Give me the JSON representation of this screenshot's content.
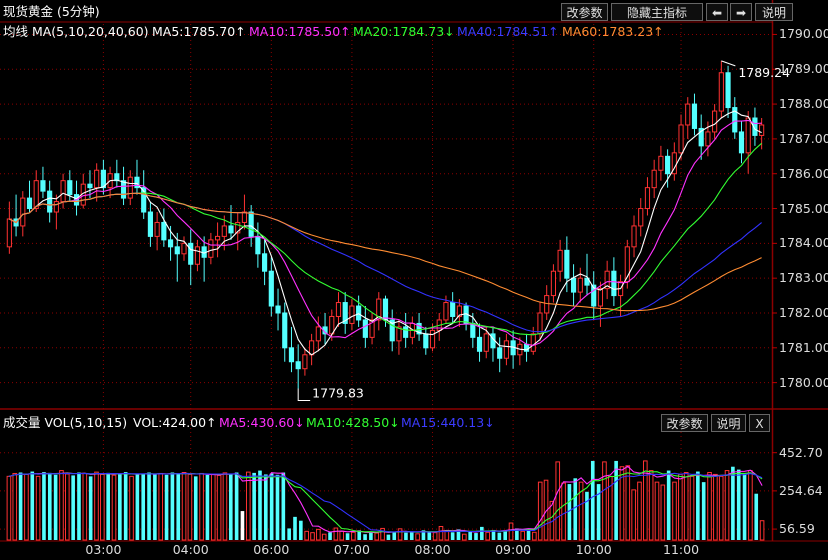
{
  "header": {
    "title": "现货黄金 (5分钟)",
    "btn_params": "改参数",
    "btn_hide": "隐藏主指标",
    "btn_left": "⬅",
    "btn_right": "➡",
    "btn_help": "说明"
  },
  "ma_legend": {
    "label": "均线 MA(5,10,20,40,60)",
    "ma5": "MA5:1785.70↑",
    "ma10": "MA10:1785.50↑",
    "ma20": "MA20:1784.73↓",
    "ma40": "MA40:1784.51↑",
    "ma60": "MA60:1783.23↑"
  },
  "vol_legend": {
    "label": "成交量 VOL(5,10,15)",
    "vol": "VOL:424.00↑",
    "ma5": "MA5:430.60↓",
    "ma10": "MA10:428.50↓",
    "ma15": "MA15:440.13↓",
    "btn_params": "改参数",
    "btn_help": "说明",
    "btn_close": "X"
  },
  "colors": {
    "up": "#ff3232",
    "down": "#54ffff",
    "ma5": "#ffffff",
    "ma10": "#ff32ff",
    "ma20": "#32ff32",
    "ma40": "#3232ff",
    "ma60": "#ff8c32",
    "grid": "#8b0000"
  },
  "chart_data": [
    {
      "type": "candlestick",
      "title": "现货黄金 (5分钟)",
      "ylim": [
        1779.3,
        1790.3
      ],
      "yticks": [
        "1790.00",
        "1789.00",
        "1788.00",
        "1787.00",
        "1786.00",
        "1785.00",
        "1784.00",
        "1783.00",
        "1782.00",
        "1781.00",
        "1780.00"
      ],
      "xticks": [
        "03:00",
        "04:00",
        "06:00",
        "07:00",
        "08:00",
        "09:00",
        "10:00",
        "11:00"
      ],
      "annotations": [
        {
          "text": "1789.24",
          "price": 1789.24
        },
        {
          "text": "1779.83",
          "price": 1779.83
        }
      ],
      "ohlc": [
        [
          1783.9,
          1785.2,
          1783.7,
          1784.7
        ],
        [
          1784.7,
          1785.4,
          1784.2,
          1784.5
        ],
        [
          1784.5,
          1785.5,
          1784.2,
          1785.3
        ],
        [
          1785.3,
          1785.8,
          1784.9,
          1785.0
        ],
        [
          1785.0,
          1786.1,
          1784.9,
          1785.8
        ],
        [
          1785.8,
          1786.2,
          1785.3,
          1785.5
        ],
        [
          1785.5,
          1785.8,
          1784.6,
          1784.9
        ],
        [
          1784.9,
          1785.4,
          1784.4,
          1785.2
        ],
        [
          1785.2,
          1786.0,
          1785.0,
          1785.8
        ],
        [
          1785.8,
          1786.1,
          1785.2,
          1785.4
        ],
        [
          1785.4,
          1785.8,
          1784.8,
          1785.1
        ],
        [
          1785.1,
          1786.0,
          1785.0,
          1785.7
        ],
        [
          1785.7,
          1786.1,
          1785.3,
          1785.6
        ],
        [
          1785.6,
          1786.3,
          1785.2,
          1786.1
        ],
        [
          1786.1,
          1786.4,
          1785.4,
          1785.6
        ],
        [
          1785.6,
          1786.2,
          1785.3,
          1786.0
        ],
        [
          1786.0,
          1786.4,
          1785.6,
          1785.8
        ],
        [
          1785.8,
          1786.2,
          1785.1,
          1785.3
        ],
        [
          1785.3,
          1786.1,
          1785.1,
          1785.9
        ],
        [
          1785.9,
          1786.4,
          1785.4,
          1785.6
        ],
        [
          1785.6,
          1786.1,
          1784.7,
          1784.9
        ],
        [
          1784.9,
          1785.2,
          1783.9,
          1784.2
        ],
        [
          1784.2,
          1784.9,
          1783.8,
          1784.6
        ],
        [
          1784.6,
          1785.0,
          1783.9,
          1784.1
        ],
        [
          1784.1,
          1784.5,
          1783.5,
          1783.9
        ],
        [
          1783.9,
          1784.3,
          1782.9,
          1783.7
        ],
        [
          1783.7,
          1784.2,
          1783.5,
          1784.0
        ],
        [
          1784.0,
          1784.4,
          1782.8,
          1783.4
        ],
        [
          1783.4,
          1784.1,
          1783.2,
          1783.9
        ],
        [
          1783.9,
          1784.2,
          1782.9,
          1783.6
        ],
        [
          1783.6,
          1784.3,
          1783.4,
          1784.1
        ],
        [
          1784.1,
          1784.6,
          1783.6,
          1784.2
        ],
        [
          1784.2,
          1784.8,
          1783.8,
          1784.5
        ],
        [
          1784.5,
          1785.1,
          1784.1,
          1784.3
        ],
        [
          1784.3,
          1784.9,
          1783.8,
          1784.6
        ],
        [
          1784.6,
          1785.4,
          1784.4,
          1784.9
        ],
        [
          1784.9,
          1785.1,
          1783.9,
          1784.2
        ],
        [
          1784.2,
          1784.6,
          1783.3,
          1783.7
        ],
        [
          1783.7,
          1784.1,
          1782.8,
          1783.2
        ],
        [
          1783.2,
          1783.6,
          1781.9,
          1782.2
        ],
        [
          1782.2,
          1782.7,
          1781.5,
          1782.0
        ],
        [
          1782.0,
          1782.3,
          1780.6,
          1781.0
        ],
        [
          1781.0,
          1781.6,
          1780.3,
          1780.6
        ],
        [
          1780.6,
          1781.1,
          1779.83,
          1780.4
        ],
        [
          1780.4,
          1781.0,
          1780.2,
          1780.8
        ],
        [
          1780.8,
          1781.4,
          1780.5,
          1781.2
        ],
        [
          1781.2,
          1781.9,
          1780.9,
          1781.6
        ],
        [
          1781.6,
          1782.0,
          1781.1,
          1781.4
        ],
        [
          1781.4,
          1782.1,
          1781.2,
          1781.9
        ],
        [
          1781.9,
          1782.6,
          1781.6,
          1782.3
        ],
        [
          1782.3,
          1782.6,
          1781.4,
          1781.7
        ],
        [
          1781.7,
          1782.4,
          1781.5,
          1782.2
        ],
        [
          1782.2,
          1782.5,
          1781.6,
          1781.8
        ],
        [
          1781.8,
          1782.2,
          1781.0,
          1781.3
        ],
        [
          1781.3,
          1782.0,
          1781.1,
          1781.8
        ],
        [
          1781.8,
          1782.6,
          1781.5,
          1782.4
        ],
        [
          1782.4,
          1782.5,
          1781.6,
          1781.8
        ],
        [
          1781.8,
          1782.1,
          1780.9,
          1781.2
        ],
        [
          1781.2,
          1781.8,
          1780.8,
          1781.6
        ],
        [
          1781.6,
          1782.0,
          1781.0,
          1781.3
        ],
        [
          1781.3,
          1781.9,
          1781.1,
          1781.7
        ],
        [
          1781.7,
          1782.0,
          1781.2,
          1781.4
        ],
        [
          1781.4,
          1781.6,
          1780.8,
          1781.0
        ],
        [
          1781.0,
          1781.7,
          1780.9,
          1781.5
        ],
        [
          1781.5,
          1782.0,
          1781.2,
          1781.8
        ],
        [
          1781.8,
          1782.5,
          1781.7,
          1782.3
        ],
        [
          1782.3,
          1782.6,
          1781.7,
          1781.9
        ],
        [
          1781.9,
          1782.4,
          1781.6,
          1782.2
        ],
        [
          1782.2,
          1782.3,
          1781.5,
          1781.7
        ],
        [
          1781.7,
          1782.0,
          1781.0,
          1781.3
        ],
        [
          1781.3,
          1781.7,
          1780.6,
          1780.9
        ],
        [
          1780.9,
          1781.6,
          1780.7,
          1781.4
        ],
        [
          1781.4,
          1781.6,
          1780.6,
          1781.0
        ],
        [
          1781.0,
          1781.3,
          1780.3,
          1780.7
        ],
        [
          1780.7,
          1781.4,
          1780.5,
          1781.2
        ],
        [
          1781.2,
          1781.5,
          1780.4,
          1780.8
        ],
        [
          1780.8,
          1781.3,
          1780.5,
          1781.1
        ],
        [
          1781.1,
          1781.4,
          1780.6,
          1780.9
        ],
        [
          1780.9,
          1781.6,
          1780.8,
          1781.4
        ],
        [
          1781.4,
          1782.3,
          1781.2,
          1782.0
        ],
        [
          1782.0,
          1782.8,
          1781.8,
          1782.5
        ],
        [
          1782.5,
          1783.4,
          1782.3,
          1783.2
        ],
        [
          1783.2,
          1784.1,
          1782.9,
          1783.8
        ],
        [
          1783.8,
          1784.2,
          1782.6,
          1783.0
        ],
        [
          1783.0,
          1783.4,
          1782.2,
          1782.6
        ],
        [
          1782.6,
          1783.3,
          1782.3,
          1783.0
        ],
        [
          1783.0,
          1783.7,
          1782.5,
          1782.8
        ],
        [
          1782.8,
          1783.2,
          1781.8,
          1782.2
        ],
        [
          1782.2,
          1782.9,
          1781.6,
          1782.7
        ],
        [
          1782.7,
          1783.5,
          1782.4,
          1783.2
        ],
        [
          1783.2,
          1783.6,
          1782.2,
          1782.5
        ],
        [
          1782.5,
          1783.1,
          1781.9,
          1782.9
        ],
        [
          1782.9,
          1784.1,
          1782.7,
          1783.9
        ],
        [
          1783.9,
          1784.8,
          1783.6,
          1784.5
        ],
        [
          1784.5,
          1785.3,
          1784.2,
          1785.0
        ],
        [
          1785.0,
          1785.9,
          1784.8,
          1785.6
        ],
        [
          1785.6,
          1786.4,
          1785.3,
          1786.1
        ],
        [
          1786.1,
          1786.8,
          1785.8,
          1786.5
        ],
        [
          1786.5,
          1786.7,
          1785.6,
          1786.0
        ],
        [
          1786.0,
          1786.9,
          1785.8,
          1786.6
        ],
        [
          1786.6,
          1787.7,
          1786.4,
          1787.4
        ],
        [
          1787.4,
          1788.2,
          1787.0,
          1788.0
        ],
        [
          1788.0,
          1788.3,
          1787.1,
          1787.3
        ],
        [
          1787.3,
          1787.7,
          1786.4,
          1786.8
        ],
        [
          1786.8,
          1787.5,
          1786.5,
          1787.2
        ],
        [
          1787.2,
          1788.0,
          1787.0,
          1787.8
        ],
        [
          1787.8,
          1789.24,
          1787.6,
          1788.9
        ],
        [
          1788.9,
          1789.1,
          1787.6,
          1787.9
        ],
        [
          1787.9,
          1788.2,
          1787.0,
          1787.2
        ],
        [
          1787.2,
          1787.5,
          1786.3,
          1786.6
        ],
        [
          1786.6,
          1787.8,
          1786.0,
          1787.6
        ],
        [
          1787.6,
          1787.9,
          1786.8,
          1787.1
        ],
        [
          1787.1,
          1787.6,
          1786.7,
          1787.4
        ]
      ]
    },
    {
      "type": "bar",
      "title": "成交量 VOL(5,10,15)",
      "ylim": [
        0,
        560
      ],
      "yticks": [
        "452.70",
        "254.64",
        "56.59"
      ],
      "white_bar_index": 40,
      "values": [
        330,
        345,
        350,
        340,
        355,
        330,
        352,
        348,
        338,
        360,
        342,
        335,
        350,
        345,
        330,
        352,
        340,
        348,
        336,
        344,
        352,
        330,
        345,
        340,
        350,
        342,
        345,
        338,
        350,
        345,
        350,
        340,
        330,
        345,
        338,
        342,
        335,
        348,
        344,
        350,
        150,
        352,
        348,
        360,
        340,
        345,
        338,
        350,
        60,
        120,
        100,
        45,
        38,
        55,
        30,
        40,
        62,
        45,
        35,
        40,
        50,
        30,
        42,
        36,
        60,
        28,
        42,
        58,
        38,
        40,
        32,
        50,
        44,
        38,
        70,
        48,
        40,
        55,
        30,
        45,
        36,
        68,
        40,
        52,
        38,
        46,
        88,
        60,
        45,
        55,
        40,
        300,
        310,
        200,
        405,
        295,
        290,
        320,
        300,
        250,
        410,
        290,
        405,
        330,
        410,
        380,
        385,
        260,
        300,
        410,
        360,
        300,
        285,
        360,
        300,
        340,
        350,
        330,
        355,
        300,
        350,
        340,
        330,
        360,
        380,
        365,
        345,
        360,
        240,
        100
      ]
    }
  ]
}
